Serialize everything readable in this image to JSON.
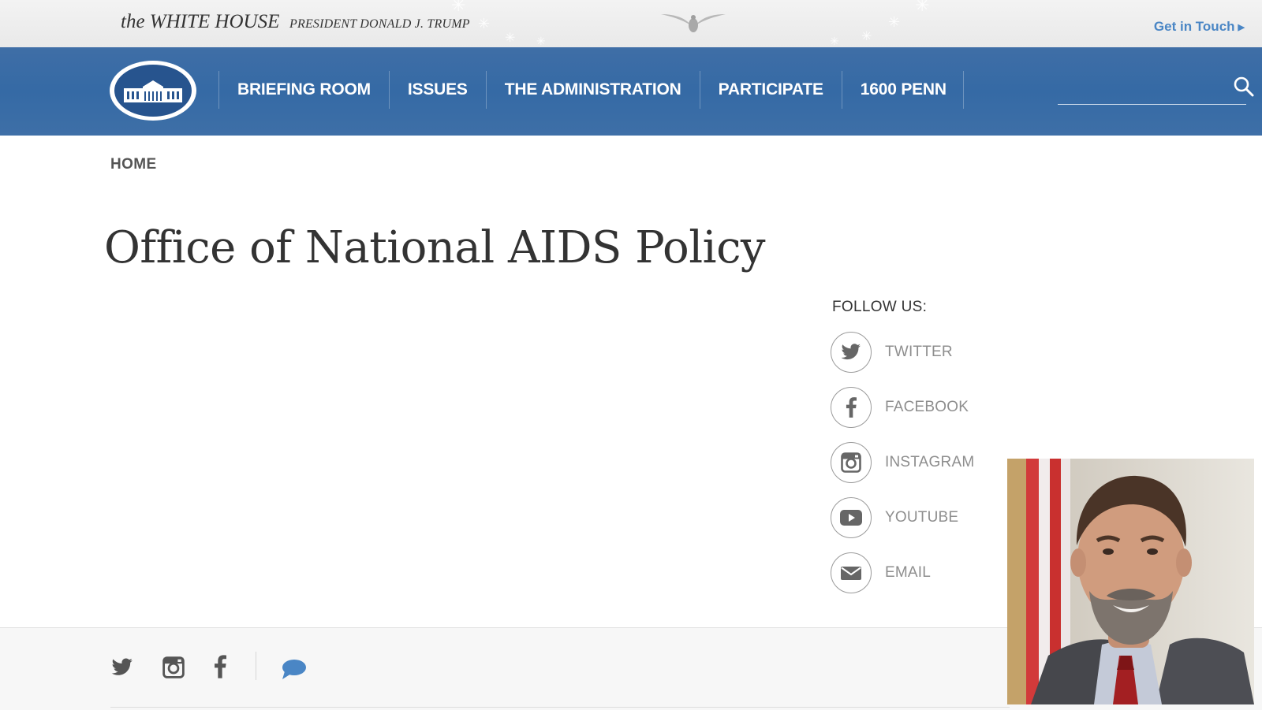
{
  "header": {
    "site_title": "the WHITE HOUSE",
    "site_subtitle": "PRESIDENT DONALD J. TRUMP",
    "get_in_touch": "Get in Touch"
  },
  "nav": {
    "items": [
      {
        "label": "BRIEFING ROOM"
      },
      {
        "label": "ISSUES"
      },
      {
        "label": "THE ADMINISTRATION"
      },
      {
        "label": "PARTICIPATE"
      },
      {
        "label": "1600 PENN"
      }
    ],
    "search_value": ""
  },
  "breadcrumb": "HOME",
  "page_title": "Office of National AIDS Policy",
  "follow": {
    "label": "FOLLOW US:",
    "items": [
      {
        "label": "TWITTER",
        "icon": "twitter-icon"
      },
      {
        "label": "FACEBOOK",
        "icon": "facebook-icon"
      },
      {
        "label": "INSTAGRAM",
        "icon": "instagram-icon"
      },
      {
        "label": "YOUTUBE",
        "icon": "youtube-icon"
      },
      {
        "label": "EMAIL",
        "icon": "email-icon"
      }
    ]
  },
  "footer": {
    "icons": [
      "twitter-icon",
      "instagram-icon",
      "facebook-icon",
      "chat-icon"
    ]
  },
  "colors": {
    "nav_blue": "#356aa5",
    "link_blue": "#4a86c5",
    "footer_bg": "#f7f7f7"
  }
}
